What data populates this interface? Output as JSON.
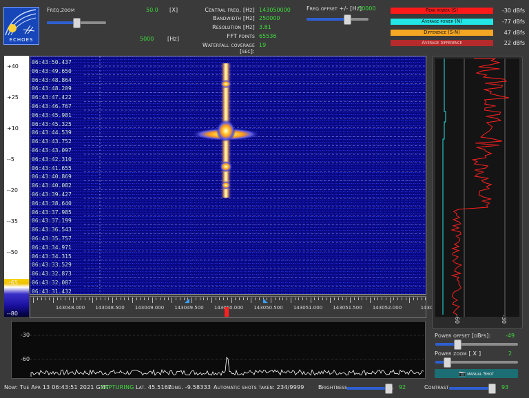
{
  "logo": {
    "text": "ECHOES"
  },
  "controls": {
    "freq_zoom": {
      "label": "Freq.zoom",
      "value": "50.0",
      "unit": "[X]",
      "level": 0.55
    },
    "freq_second": {
      "value": "5000",
      "unit": "[Hz]"
    },
    "central_freq": {
      "label": "Central freq. [Hz]",
      "value": "143050000"
    },
    "bandwidth": {
      "label": "Bandwidth [Hz]",
      "value": "250000"
    },
    "resolution": {
      "label": "Resolution [Hz]",
      "value": "3.81"
    },
    "fft_points": {
      "label": "FFT points",
      "value": "65536"
    },
    "waterfall_coverage": {
      "label": "Waterfall coverage [sec]:",
      "value": "19"
    },
    "freq_offset": {
      "label": "Freq.offset +/- [Hz]",
      "value": "50000",
      "level": 0.7
    }
  },
  "legend": [
    {
      "label": "Peak power (S)",
      "value": "-30 dBfs",
      "color": "#ff1a1a"
    },
    {
      "label": "Average power (N)",
      "value": "-77 dBfs",
      "color": "#22e6e6"
    },
    {
      "label": "Difference (S-N)",
      "value": "47 dBfs",
      "color": "#f5a623"
    },
    {
      "label": "Average difference",
      "value": "22 dBfs",
      "color": "#b52a2a"
    }
  ],
  "scale_labels": [
    "+40",
    "+25",
    "+10",
    "--5",
    "--20",
    "--35",
    "--50",
    "--65",
    "--80"
  ],
  "timestamps": [
    "06:43:50.437",
    "06:43:49.650",
    "06:43:48.864",
    "06:43:48.209",
    "06:43:47.422",
    "06:43:46.767",
    "06:43:45.981",
    "06:43:45.325",
    "06:43:44.539",
    "06:43:43.752",
    "06:43:43.097",
    "06:43:42.310",
    "06:43:41.655",
    "06:43:40.869",
    "06:43:40.082",
    "06:43:39.427",
    "06:43:38.640",
    "06:43:37.985",
    "06:43:37.199",
    "06:43:36.543",
    "06:43:35.757",
    "06:43:34.971",
    "06:43:34.315",
    "06:43:33.529",
    "06:43:32.873",
    "06:43:32.087",
    "06:43:31.432"
  ],
  "freq_ticks": [
    "143048.000",
    "143048.500",
    "143049.000",
    "143049.500",
    "143050.000",
    "143050.500",
    "143051.000",
    "143051.500",
    "143052.000",
    "1430"
  ],
  "spectrum": {
    "labels": [
      "-30",
      "-60"
    ]
  },
  "vertical_plot": {
    "labels": [
      "-60",
      "-30"
    ]
  },
  "power_offset": {
    "label": "Power offset [dBfs]:",
    "value": "-49",
    "level": 0.25
  },
  "power_zoom": {
    "label": "Power zoom [ X ]",
    "value": "2",
    "level": 0.12
  },
  "manual_shot": {
    "label": "manual Shot"
  },
  "status": {
    "now": "Now: Tue Apr 13 06:43:51 2021 GMT",
    "state": "CAPTURING",
    "lat": "Lat. 45.5167",
    "long": "Long. -9.58333",
    "shots": "Automatic shots taken: 234/9999",
    "brightness": {
      "label": "Brightness",
      "value": "92",
      "level": 0.88
    },
    "contrast": {
      "label": "Contrast",
      "value": "93",
      "level": 0.9
    }
  }
}
